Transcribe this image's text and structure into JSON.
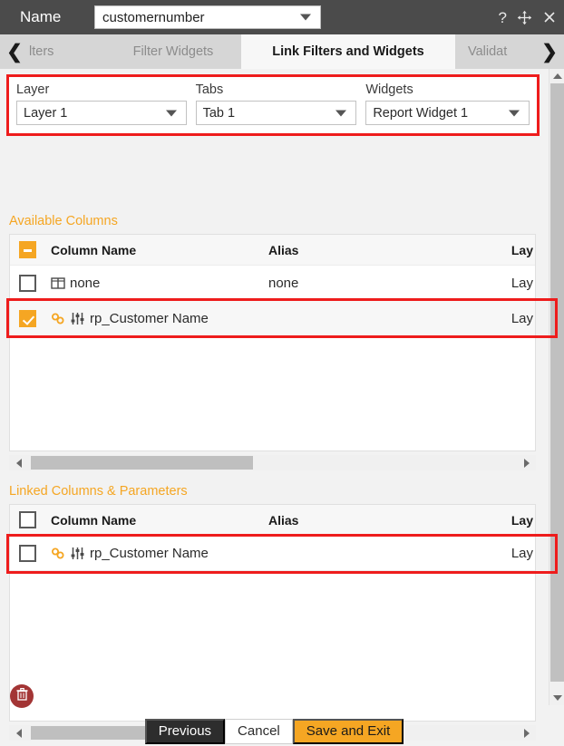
{
  "titlebar": {
    "name_label": "Name",
    "name_value": "customernumber",
    "help_icon": "question-mark-icon",
    "move_icon": "move-arrows-icon",
    "close_icon": "close-icon"
  },
  "tabbar": {
    "prev_arrow": "❮",
    "next_arrow": "❯",
    "tabs": [
      {
        "label": "lters",
        "active": false
      },
      {
        "label": "Filter Widgets",
        "active": false
      },
      {
        "label": "Link Filters and Widgets",
        "active": true
      },
      {
        "label": "Validat",
        "active": false
      }
    ]
  },
  "selectors": [
    {
      "label": "Layer",
      "value": "Layer 1"
    },
    {
      "label": "Tabs",
      "value": "Tab 1"
    },
    {
      "label": "Widgets",
      "value": "Report Widget 1"
    }
  ],
  "available": {
    "title": "Available Columns",
    "headers": {
      "name": "Column Name",
      "alias": "Alias",
      "lay": "Lay"
    },
    "header_checkbox": "indeterminate",
    "rows": [
      {
        "checked": false,
        "name": "none",
        "alias": "none",
        "lay": "Lay",
        "icons": "table-columns-icon"
      },
      {
        "checked": true,
        "name": "rp_Customer Name",
        "alias": "",
        "lay": "Lay",
        "icons": "link-icon sliders-icon"
      }
    ]
  },
  "linked": {
    "title": "Linked Columns & Parameters",
    "headers": {
      "name": "Column Name",
      "alias": "Alias",
      "lay": "Lay"
    },
    "header_checkbox": "unchecked",
    "rows": [
      {
        "checked": false,
        "name": "rp_Customer Name",
        "alias": "",
        "lay": "Lay",
        "icons": "link-icon sliders-icon"
      }
    ]
  },
  "delete_button": {
    "icon": "trash-icon"
  },
  "footer": {
    "previous": "Previous",
    "cancel": "Cancel",
    "save": "Save and Exit"
  },
  "colors": {
    "accent": "#f5a623",
    "highlight": "#ee1c1c",
    "titlebar": "#4b4b4b",
    "delete": "#a33535"
  }
}
